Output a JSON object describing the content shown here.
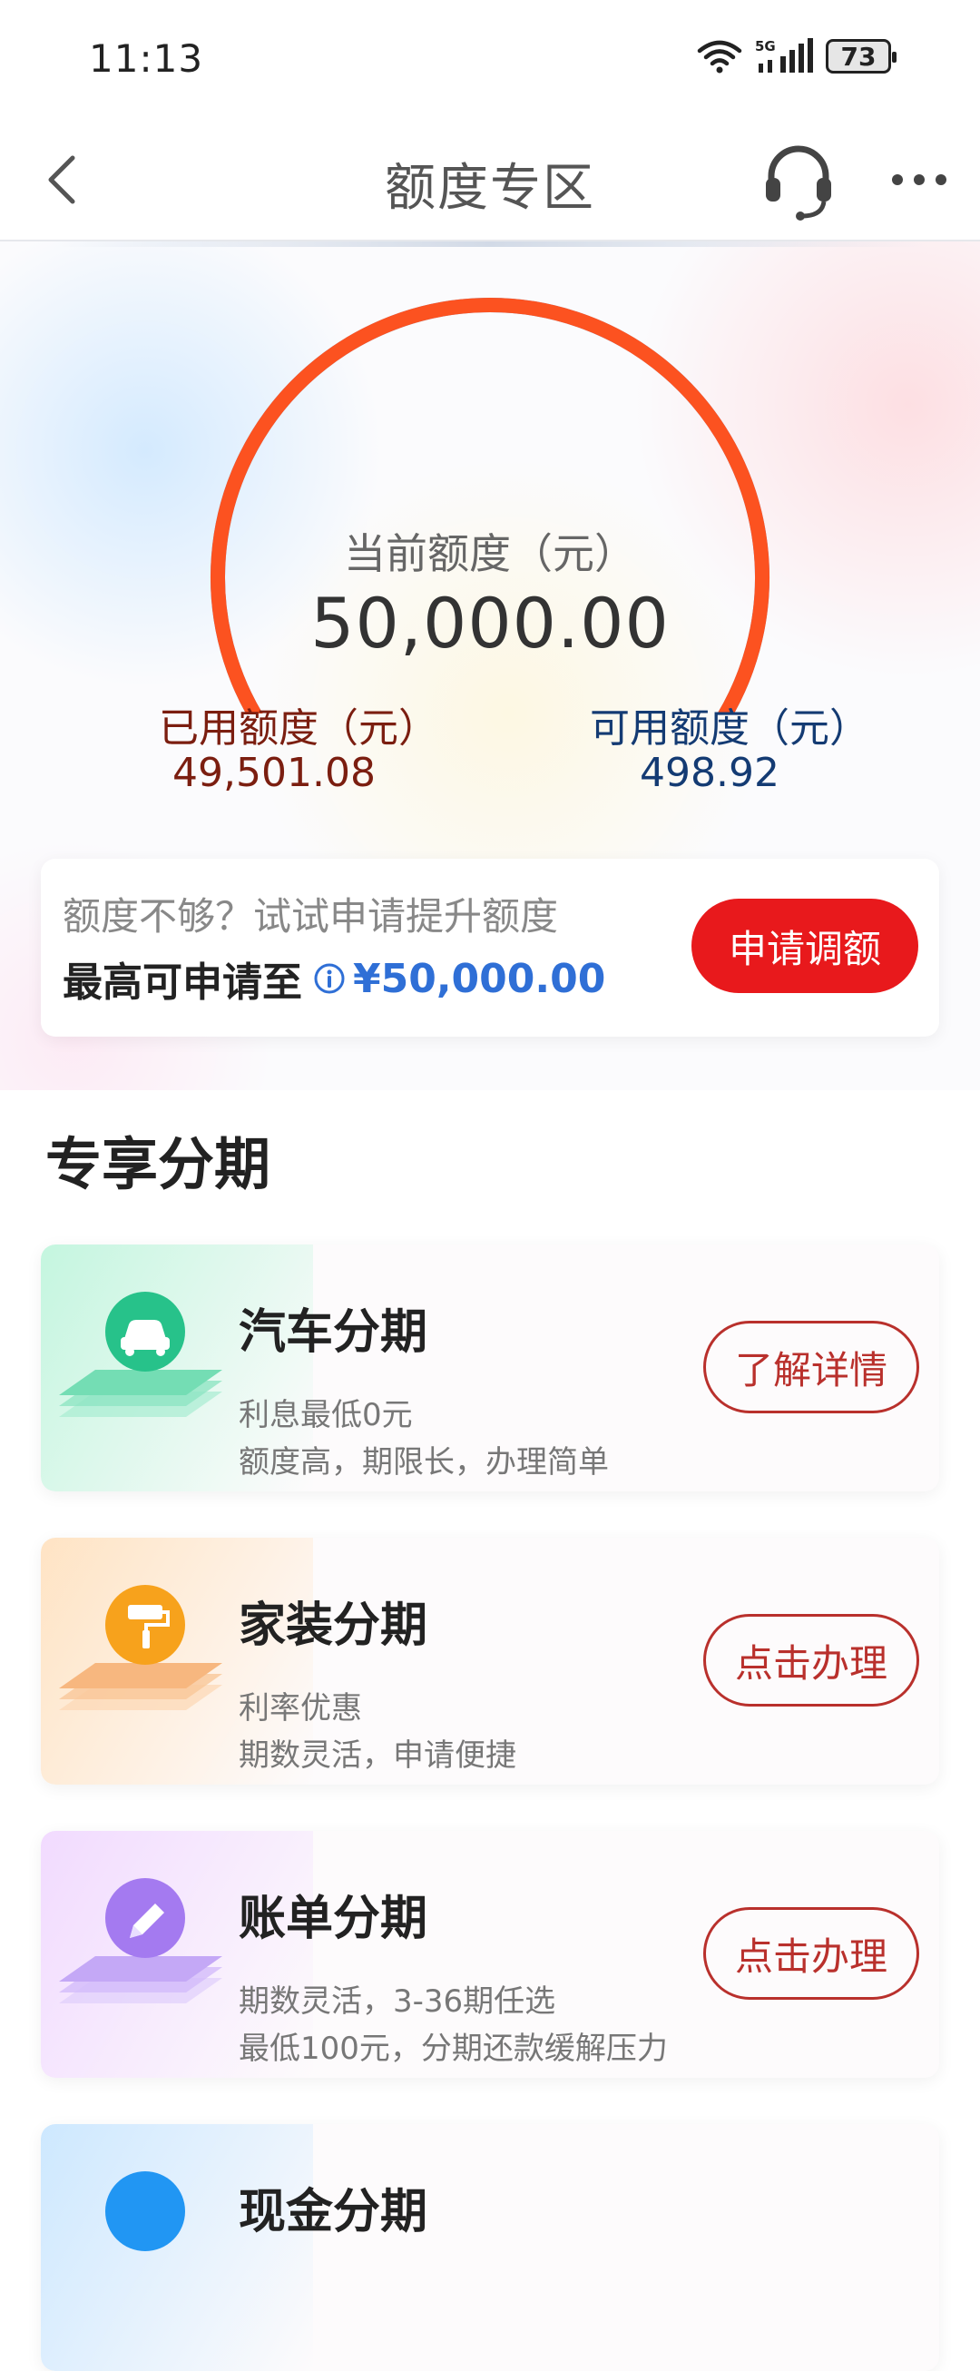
{
  "status_bar": {
    "time": "11:13",
    "network": "5G",
    "battery": "73"
  },
  "header": {
    "title": "额度专区"
  },
  "gauge": {
    "label": "当前额度（元）",
    "value": "50,000.00",
    "used_label": "已用额度（元）",
    "used_value": "49,501.08",
    "available_label": "可用额度（元）",
    "available_value": "498.92",
    "used_fraction": 0.99,
    "colors": {
      "used": "#fc5220",
      "available": "#5b9cf0"
    }
  },
  "raise_card": {
    "hint": "额度不够？试试申请提升额度",
    "max_label": "最高可申请至",
    "max_value": "¥50,000.00",
    "button_label": "申请调额"
  },
  "section": {
    "title": "专享分期"
  },
  "products": [
    {
      "title": "汽车分期",
      "desc1": "利息最低0元",
      "desc2": "额度高，期限长，办理简单",
      "button": "了解详情",
      "icon": "car-icon",
      "color": "#27c28a"
    },
    {
      "title": "家装分期",
      "desc1": "利率优惠",
      "desc2": "期数灵活，申请便捷",
      "button": "点击办理",
      "icon": "paint-roller-icon",
      "color": "#f7a21c"
    },
    {
      "title": "账单分期",
      "desc1": "期数灵活，3-36期任选",
      "desc2": "最低100元，分期还款缓解压力",
      "button": "点击办理",
      "icon": "pen-icon",
      "color": "#a47af0"
    },
    {
      "title": "现金分期",
      "icon": "cash-icon",
      "color": "#2196f3"
    }
  ]
}
